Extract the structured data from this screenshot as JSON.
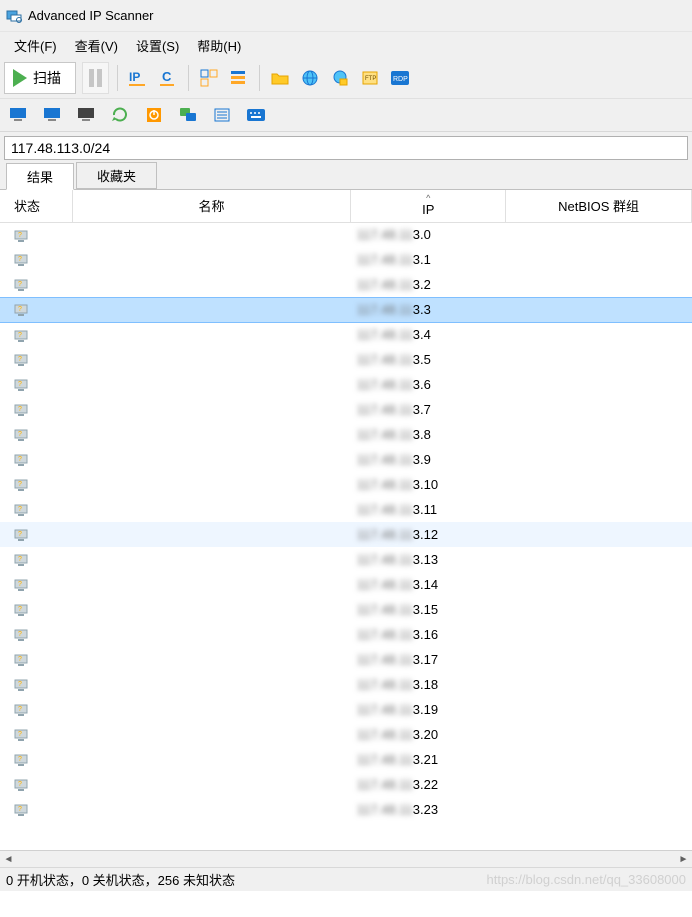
{
  "window": {
    "title": "Advanced IP Scanner"
  },
  "menu": {
    "file": "文件(F)",
    "view": "查看(V)",
    "settings": "设置(S)",
    "help": "帮助(H)"
  },
  "toolbar": {
    "scan_label": "扫描",
    "pause_label": "暂停"
  },
  "ip_input": {
    "value": "117.48.113.0/24"
  },
  "tabs": {
    "results": "结果",
    "favorites": "收藏夹"
  },
  "columns": {
    "status": "状态",
    "name": "名称",
    "ip": "IP",
    "ip_sort_arrow": "^",
    "netbios": "NetBIOS 群组"
  },
  "rows": [
    {
      "ip_prefix": "117.48.11",
      "ip_suffix": "3.0",
      "name": "",
      "netbios": "",
      "sel": false,
      "hov": false
    },
    {
      "ip_prefix": "117.48.11",
      "ip_suffix": "3.1",
      "name": "",
      "netbios": "",
      "sel": false,
      "hov": false
    },
    {
      "ip_prefix": "117.48.11",
      "ip_suffix": "3.2",
      "name": "",
      "netbios": "",
      "sel": false,
      "hov": false
    },
    {
      "ip_prefix": "117.48.11",
      "ip_suffix": "3.3",
      "name": "",
      "netbios": "",
      "sel": true,
      "hov": false
    },
    {
      "ip_prefix": "117.48.11",
      "ip_suffix": "3.4",
      "name": "",
      "netbios": "",
      "sel": false,
      "hov": false
    },
    {
      "ip_prefix": "117.48.11",
      "ip_suffix": "3.5",
      "name": "",
      "netbios": "",
      "sel": false,
      "hov": false
    },
    {
      "ip_prefix": "117.48.11",
      "ip_suffix": "3.6",
      "name": "",
      "netbios": "",
      "sel": false,
      "hov": false
    },
    {
      "ip_prefix": "117.48.11",
      "ip_suffix": "3.7",
      "name": "",
      "netbios": "",
      "sel": false,
      "hov": false
    },
    {
      "ip_prefix": "117.48.11",
      "ip_suffix": "3.8",
      "name": "",
      "netbios": "",
      "sel": false,
      "hov": false
    },
    {
      "ip_prefix": "117.48.11",
      "ip_suffix": "3.9",
      "name": "",
      "netbios": "",
      "sel": false,
      "hov": false
    },
    {
      "ip_prefix": "117.48.11",
      "ip_suffix": "3.10",
      "name": "",
      "netbios": "",
      "sel": false,
      "hov": false
    },
    {
      "ip_prefix": "117.48.11",
      "ip_suffix": "3.11",
      "name": "",
      "netbios": "",
      "sel": false,
      "hov": false
    },
    {
      "ip_prefix": "117.48.11",
      "ip_suffix": "3.12",
      "name": "",
      "netbios": "",
      "sel": false,
      "hov": true
    },
    {
      "ip_prefix": "117.48.11",
      "ip_suffix": "3.13",
      "name": "",
      "netbios": "",
      "sel": false,
      "hov": false
    },
    {
      "ip_prefix": "117.48.11",
      "ip_suffix": "3.14",
      "name": "",
      "netbios": "",
      "sel": false,
      "hov": false
    },
    {
      "ip_prefix": "117.48.11",
      "ip_suffix": "3.15",
      "name": "",
      "netbios": "",
      "sel": false,
      "hov": false
    },
    {
      "ip_prefix": "117.48.11",
      "ip_suffix": "3.16",
      "name": "",
      "netbios": "",
      "sel": false,
      "hov": false
    },
    {
      "ip_prefix": "117.48.11",
      "ip_suffix": "3.17",
      "name": "",
      "netbios": "",
      "sel": false,
      "hov": false
    },
    {
      "ip_prefix": "117.48.11",
      "ip_suffix": "3.18",
      "name": "",
      "netbios": "",
      "sel": false,
      "hov": false
    },
    {
      "ip_prefix": "117.48.11",
      "ip_suffix": "3.19",
      "name": "",
      "netbios": "",
      "sel": false,
      "hov": false
    },
    {
      "ip_prefix": "117.48.11",
      "ip_suffix": "3.20",
      "name": "",
      "netbios": "",
      "sel": false,
      "hov": false
    },
    {
      "ip_prefix": "117.48.11",
      "ip_suffix": "3.21",
      "name": "",
      "netbios": "",
      "sel": false,
      "hov": false
    },
    {
      "ip_prefix": "117.48.11",
      "ip_suffix": "3.22",
      "name": "",
      "netbios": "",
      "sel": false,
      "hov": false
    },
    {
      "ip_prefix": "117.48.11",
      "ip_suffix": "3.23",
      "name": "",
      "netbios": "",
      "sel": false,
      "hov": false
    }
  ],
  "statusbar": {
    "text": "0 开机状态，0 关机状态，256 未知状态",
    "watermark": "https://blog.csdn.net/qq_33608000"
  },
  "icons": {
    "ip": "IP",
    "c": "C",
    "rdp": "RDP"
  }
}
